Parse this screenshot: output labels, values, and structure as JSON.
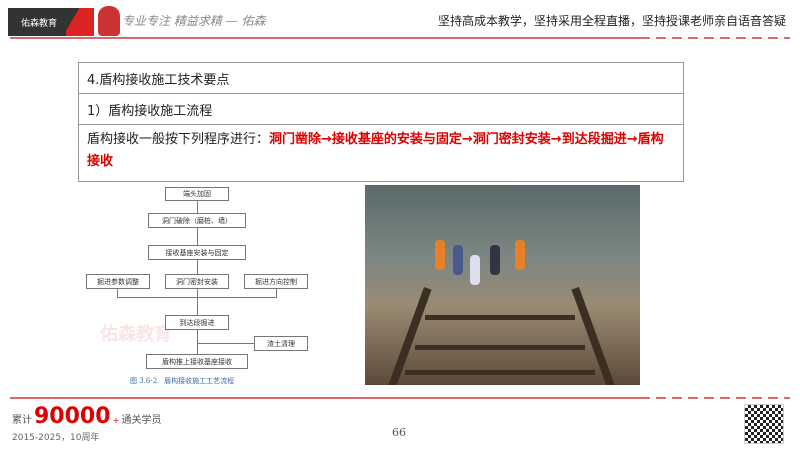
{
  "header": {
    "logo_text": "佑森教育",
    "script_slogan": "专业专注 精益求精 — 佑森",
    "motto": "坚持高成本教学，坚持采用全程直播，坚持授课老师亲自语音答疑"
  },
  "content": {
    "section_title": "4.盾构接收施工技术要点",
    "subsection_title": "1）盾构接收施工流程",
    "intro": "盾构接收一般按下列程序进行：",
    "highlight": "洞门凿除→接收基座的安装与固定→洞门密封安装→到达段掘进→盾构接收"
  },
  "flowchart": {
    "nodes": [
      "端头加固",
      "洞门破除（磨桩、墙）",
      "接收基座安装与固定",
      "掘进参数调整",
      "洞门密封安装",
      "掘进方向控制",
      "到达段掘进",
      "渣土清理",
      "盾构推上接收基座接收"
    ],
    "caption": "图 3.6-2　盾构接收施工工艺流程"
  },
  "watermark": "佑森教育",
  "footer": {
    "prefix": "累计",
    "count": "90000",
    "plus": "+",
    "suffix": "通关学员",
    "years": "2015-2025，10周年",
    "page": "66"
  }
}
